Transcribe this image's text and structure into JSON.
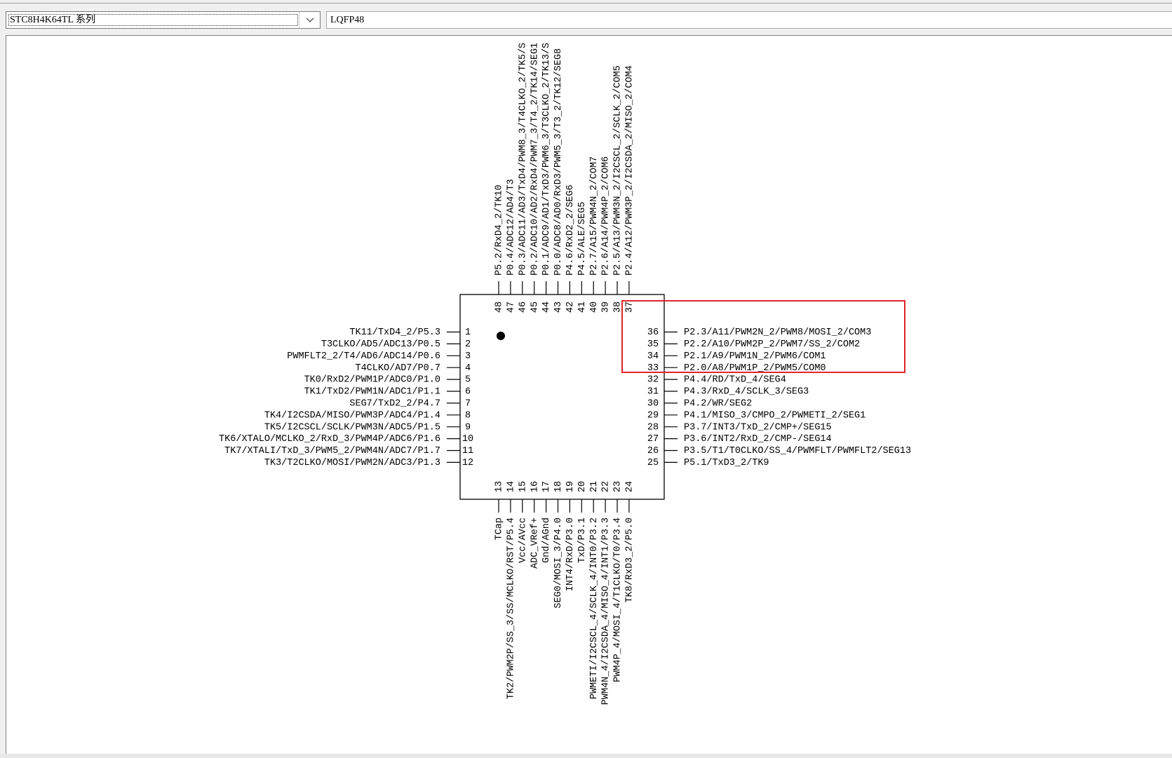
{
  "series_select": {
    "value": "STC8H4K64TL 系列",
    "arrow_icon": "chevron-down-icon"
  },
  "package": {
    "value": "LQFP48"
  },
  "chip": {
    "pin1_marker_icon": "pin1-dot-icon",
    "highlight_color": "#e0242b"
  },
  "pins": {
    "left": [
      {
        "num": "1",
        "label": "TK11/TxD4_2/P5.3"
      },
      {
        "num": "2",
        "label": "T3CLKO/AD5/ADC13/P0.5"
      },
      {
        "num": "3",
        "label": "PWMFLT2_2/T4/AD6/ADC14/P0.6"
      },
      {
        "num": "4",
        "label": "T4CLKO/AD7/P0.7"
      },
      {
        "num": "5",
        "label": "TK0/RxD2/PWM1P/ADC0/P1.0"
      },
      {
        "num": "6",
        "label": "TK1/TxD2/PWM1N/ADC1/P1.1"
      },
      {
        "num": "7",
        "label": "SEG7/TxD2_2/P4.7"
      },
      {
        "num": "8",
        "label": "TK4/I2CSDA/MISO/PWM3P/ADC4/P1.4"
      },
      {
        "num": "9",
        "label": "TK5/I2CSCL/SCLK/PWM3N/ADC5/P1.5"
      },
      {
        "num": "10",
        "label": "TK6/XTALO/MCLKO_2/RxD_3/PWM4P/ADC6/P1.6"
      },
      {
        "num": "11",
        "label": "TK7/XTALI/TxD_3/PWM5_2/PWM4N/ADC7/P1.7"
      },
      {
        "num": "12",
        "label": "TK3/T2CLKO/MOSI/PWM2N/ADC3/P1.3"
      }
    ],
    "right": [
      {
        "num": "36",
        "label": "P2.3/A11/PWM2N_2/PWM8/MOSI_2/COM3"
      },
      {
        "num": "35",
        "label": "P2.2/A10/PWM2P_2/PWM7/SS_2/COM2"
      },
      {
        "num": "34",
        "label": "P2.1/A9/PWM1N_2/PWM6/COM1"
      },
      {
        "num": "33",
        "label": "P2.0/A8/PWM1P_2/PWM5/COM0"
      },
      {
        "num": "32",
        "label": "P4.4/RD/TxD_4/SEG4"
      },
      {
        "num": "31",
        "label": "P4.3/RxD_4/SCLK_3/SEG3"
      },
      {
        "num": "30",
        "label": "P4.2/WR/SEG2"
      },
      {
        "num": "29",
        "label": "P4.1/MISO_3/CMPO_2/PWMETI_2/SEG1"
      },
      {
        "num": "28",
        "label": "P3.7/INT3/TxD_2/CMP+/SEG15"
      },
      {
        "num": "27",
        "label": "P3.6/INT2/RxD_2/CMP-/SEG14"
      },
      {
        "num": "26",
        "label": "P3.5/T1/T0CLKO/SS_4/PWMFLT/PWMFLT2/SEG13"
      },
      {
        "num": "25",
        "label": "P5.1/TxD3_2/TK9"
      }
    ],
    "top": [
      {
        "num": "48",
        "label": "P5.2/RxD4_2/TK10"
      },
      {
        "num": "47",
        "label": "P0.4/ADC12/AD4/T3"
      },
      {
        "num": "46",
        "label": "P0.3/ADC11/AD3/TxD4/PWM8_3/T4CLKO_2/TK5/S"
      },
      {
        "num": "45",
        "label": "P0.2/ADC10/AD2/RxD4/PWM7_3/T4_2/TK14/SEG1"
      },
      {
        "num": "44",
        "label": "P0.1/ADC9/AD1/TxD3/PWM6_3/T3CLKO_2/TK13/S"
      },
      {
        "num": "43",
        "label": "P0.0/ADC8/AD0/RxD3/PWM5_3/T3_2/TK12/SEG8"
      },
      {
        "num": "42",
        "label": "P4.6/RxD2_2/SEG6"
      },
      {
        "num": "41",
        "label": "P4.5/ALE/SEG5"
      },
      {
        "num": "40",
        "label": "P2.7/A15/PWM4N_2/COM7"
      },
      {
        "num": "39",
        "label": "P2.6/A14/PWM4P_2/COM6"
      },
      {
        "num": "38",
        "label": "P2.5/A13/PWM3N_2/I2CSCL_2/SCLK_2/COM5"
      },
      {
        "num": "37",
        "label": "P2.4/A12/PWM3P_2/I2CSDA_2/MISO_2/COM4"
      }
    ],
    "bottom": [
      {
        "num": "13",
        "label": "TCap"
      },
      {
        "num": "14",
        "label": "TK2/PWM2P/SS_3/SS/MCLKO/RST/P5.4"
      },
      {
        "num": "15",
        "label": "Vcc/AVcc"
      },
      {
        "num": "16",
        "label": "ADC_VRef+"
      },
      {
        "num": "17",
        "label": "Gnd/AGnd"
      },
      {
        "num": "18",
        "label": "SEG0/MOSI_3/P4.0"
      },
      {
        "num": "19",
        "label": "INT4/RxD/P3.0"
      },
      {
        "num": "20",
        "label": "TxD/P3.1"
      },
      {
        "num": "21",
        "label": "PWMETI/I2CSCL_4/SCLK_4/INT0/P3.2"
      },
      {
        "num": "22",
        "label": "PWM4N_4/I2CSDA_4/MISO_4/INT1/P3.3"
      },
      {
        "num": "23",
        "label": "PWM4P_4/MOSI_4/T1CLKO/T0/P3.4"
      },
      {
        "num": "24",
        "label": "TK8/RxD3_2/P5.0"
      }
    ]
  }
}
